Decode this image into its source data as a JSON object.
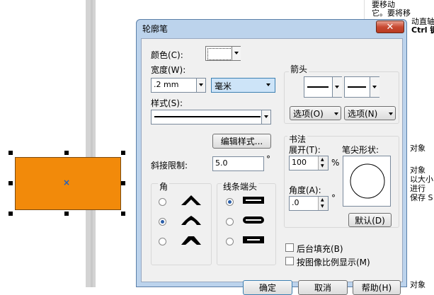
{
  "background": {
    "doc_lines": [
      "要移动",
      "它。要将移",
      "动直轴",
      "Ctrl 键",
      "对象",
      "对象",
      "以大小",
      "进行",
      "保存 S",
      "对象"
    ]
  },
  "dialog": {
    "title": "轮廓笔",
    "close_glyph": "✕",
    "color_label": "颜色(C):",
    "width_label": "宽度(W):",
    "width_value": ".2 mm",
    "unit_value": "毫米",
    "style_label": "样式(S):",
    "edit_style_button": "编辑样式...",
    "miter_label": "斜接限制:",
    "miter_value": "5.0",
    "degree": "°",
    "corners_label": "角",
    "linecaps_label": "线条端头",
    "arrows_label": "箭头",
    "options_left": "选项(O)",
    "options_right": "选项(N)",
    "calligraphy_label": "书法",
    "stretch_label": "展开(T):",
    "stretch_value": "100",
    "percent": "%",
    "angle_label": "角度(A):",
    "angle_value": ".0",
    "nib_shape_label": "笔尖形状:",
    "default_button": "默认(D)",
    "behind_fill_label": "后台填充(B)",
    "scale_with_image_label": "按图像比例显示(M)",
    "ok_button": "确定",
    "cancel_button": "取消",
    "help_button": "帮助(H)"
  },
  "colors": {
    "object_fill": "#f28a0a",
    "dialog_frame": "#bcd3ec",
    "selection_blue": "#2a5ea8"
  }
}
